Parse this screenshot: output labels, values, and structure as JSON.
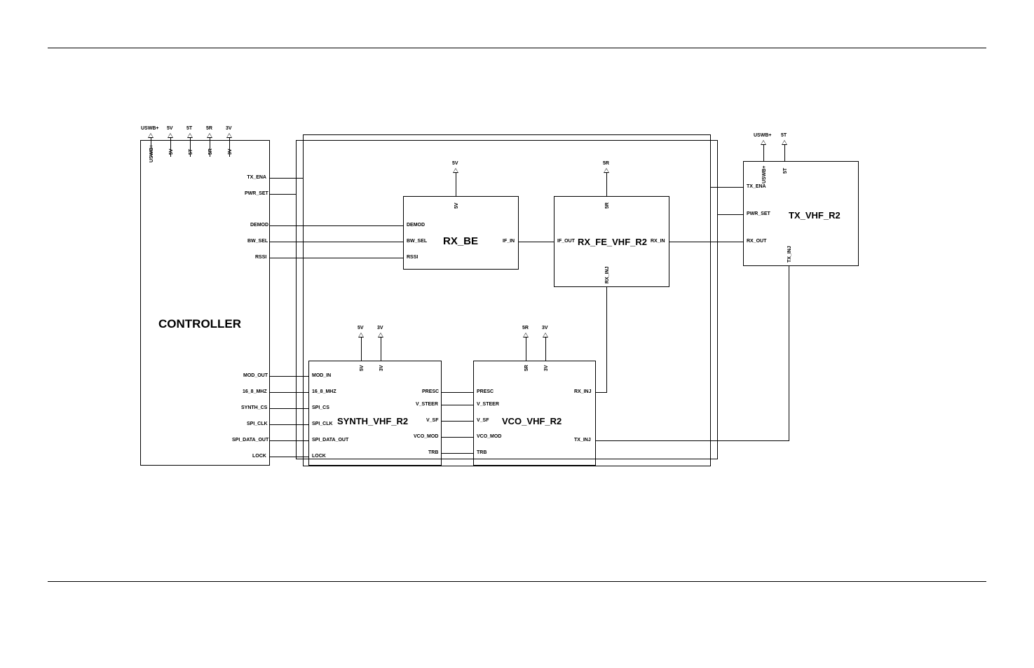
{
  "blocks": {
    "controller": {
      "title": "CONTROLLER",
      "power_top": [
        "USWB+",
        "5V",
        "5T",
        "5R",
        "3V"
      ],
      "power_in": [
        "USWB+",
        "5V",
        "5T",
        "5R",
        "3V"
      ],
      "pins_right_upper": [
        "TX_ENA",
        "PWR_SET",
        "DEMOD",
        "BW_SEL",
        "RSSI"
      ],
      "pins_right_lower": [
        "MOD_OUT",
        "16_8_MHZ",
        "SYNTH_CS",
        "SPI_CLK",
        "SPI_DATA_OUT",
        "LOCK"
      ]
    },
    "rx_be": {
      "title": "RX_BE",
      "power_top": [
        "5V"
      ],
      "power_in": [
        "5V"
      ],
      "pins_left": [
        "DEMOD",
        "BW_SEL",
        "RSSI"
      ],
      "pins_right": [
        "IF_IN"
      ]
    },
    "rx_fe": {
      "title": "RX_FE_VHF_R2",
      "power_top": [
        "5R"
      ],
      "power_in": [
        "5R"
      ],
      "pins_left": [
        "IF_OUT"
      ],
      "pins_right": [
        "RX_IN"
      ],
      "pins_bottom": [
        "RX_INJ"
      ]
    },
    "tx": {
      "title": "TX_VHF_R2",
      "power_top": [
        "USWB+",
        "5T"
      ],
      "power_in": [
        "USWB+",
        "5T"
      ],
      "pins_left": [
        "TX_ENA",
        "PWR_SET",
        "RX_OUT"
      ],
      "pins_bottom": [
        "TX_INJ"
      ]
    },
    "synth": {
      "title": "SYNTH_VHF_R2",
      "power_top": [
        "5V",
        "3V"
      ],
      "power_in": [
        "5V",
        "3V"
      ],
      "pins_left": [
        "MOD_IN",
        "16_8_MHZ",
        "SPI_CS",
        "SPI_CLK",
        "SPI_DATA_OUT",
        "LOCK"
      ],
      "pins_right": [
        "PRESC",
        "V_STEER",
        "V_SF",
        "VCO_MOD",
        "TRB"
      ]
    },
    "vco": {
      "title": "VCO_VHF_R2",
      "power_top": [
        "5R",
        "3V"
      ],
      "power_in": [
        "5R",
        "3V"
      ],
      "pins_left": [
        "PRESC",
        "V_STEER",
        "V_SF",
        "VCO_MOD",
        "TRB"
      ],
      "pins_right": [
        "RX_INJ",
        "TX_INJ"
      ]
    }
  }
}
